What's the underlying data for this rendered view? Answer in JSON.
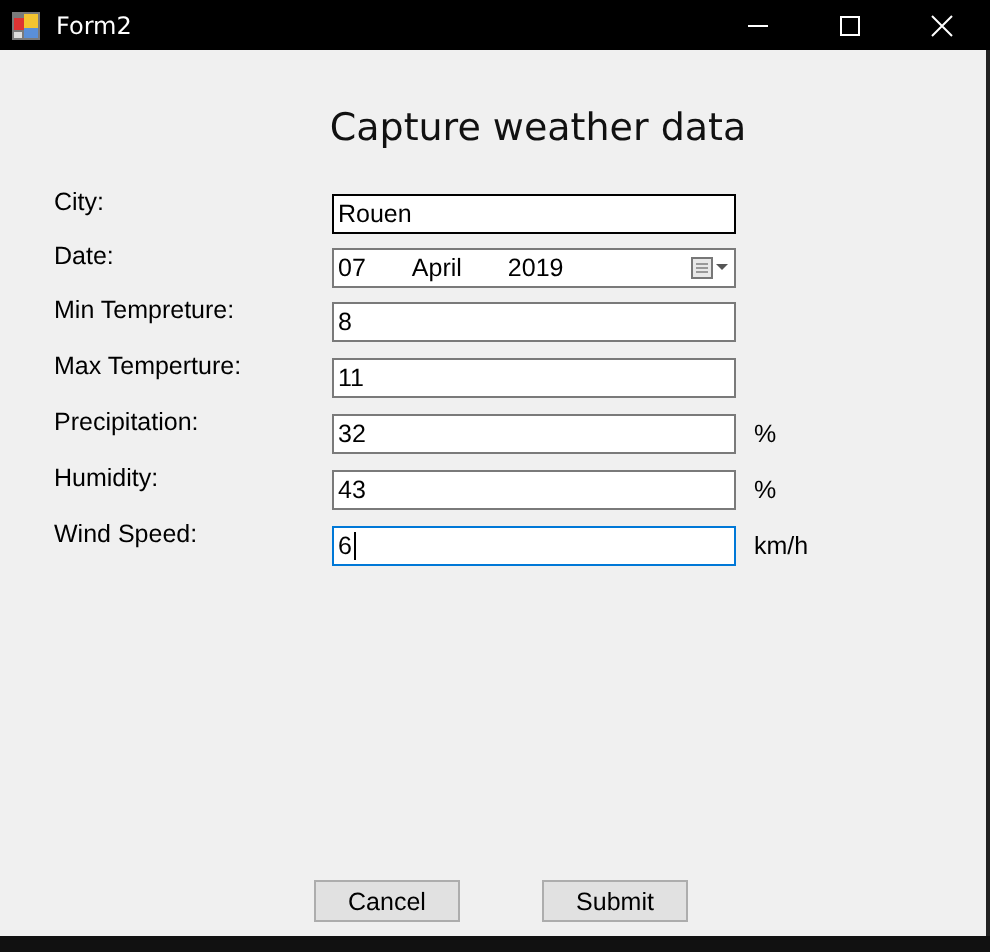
{
  "window": {
    "title": "Form2"
  },
  "heading": "Capture weather data",
  "fields": [
    {
      "label": "City:",
      "kind": "text",
      "value": "Rouen",
      "hovered": true,
      "focused": false
    },
    {
      "label": "Date:",
      "kind": "date",
      "day": "07",
      "month": "April",
      "year": "2019",
      "hovered": false,
      "focused": false
    },
    {
      "label": "Min Tempreture:",
      "kind": "text",
      "value": "8",
      "hovered": false,
      "focused": false
    },
    {
      "label": "Max Temperture:",
      "kind": "text",
      "value": "11",
      "hovered": false,
      "focused": false
    },
    {
      "label": "Precipitation:",
      "kind": "text",
      "value": "32",
      "unit": "%",
      "hovered": false,
      "focused": false
    },
    {
      "label": "Humidity:",
      "kind": "text",
      "value": "43",
      "unit": "%",
      "hovered": false,
      "focused": false
    },
    {
      "label": "Wind Speed:",
      "kind": "text",
      "value": "6",
      "unit": "km/h",
      "hovered": false,
      "focused": true
    }
  ],
  "buttons": [
    "Cancel",
    "Submit"
  ]
}
